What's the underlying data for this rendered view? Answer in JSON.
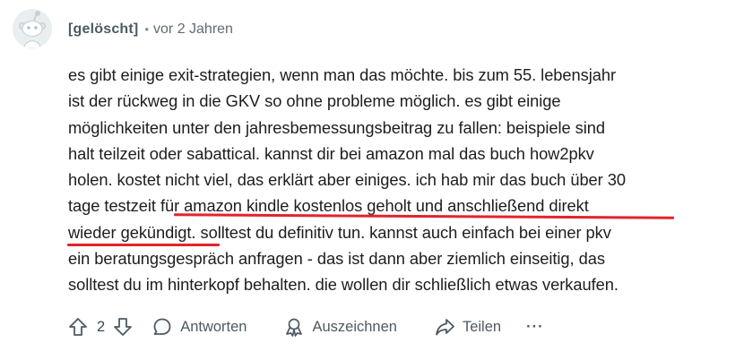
{
  "comment": {
    "author": "[gelöscht]",
    "separator": "•",
    "time": "vor 2 Jahren",
    "lines": [
      "es gibt einige exit-strategien, wenn man das möchte. bis zum 55. lebensjahr",
      "ist der rückweg in die GKV so ohne probleme möglich. es gibt einige",
      "möglichkeiten unter den jahresbemessungsbeitrag zu fallen: beispiele sind",
      "halt teilzeit oder sabattical. kannst dir bei amazon mal das buch how2pkv",
      "holen. kostet nicht viel, das erklärt aber einiges. ich hab mir das buch über 30"
    ],
    "line6_plain": "tage testzeit ",
    "line6_underlined": "für amazon kindle kostenlos geholt und anschließend direkt",
    "line7_underlined": "wieder gekündigt.",
    "line7_plain": " solltest du definitiv tun. kannst auch einfach bei einer pkv",
    "line8": "ein beratungsgespräch anfragen - das ist dann aber ziemlich einseitig, das",
    "line9": "solltest du im hinterkopf behalten. die wollen dir schließlich etwas verkaufen."
  },
  "actions": {
    "vote_count": "2",
    "reply_label": "Antworten",
    "award_label": "Auszeichnen",
    "share_label": "Teilen",
    "more_label": "···"
  },
  "colors": {
    "underline_annotation": "#e2242c",
    "meta_text": "#5f6c73"
  },
  "icons": {
    "avatar": "snoo-avatar-icon",
    "upvote": "arrow-up-icon",
    "downvote": "arrow-down-icon",
    "reply": "speech-bubble-icon",
    "award": "award-icon",
    "share": "share-arrow-icon"
  }
}
